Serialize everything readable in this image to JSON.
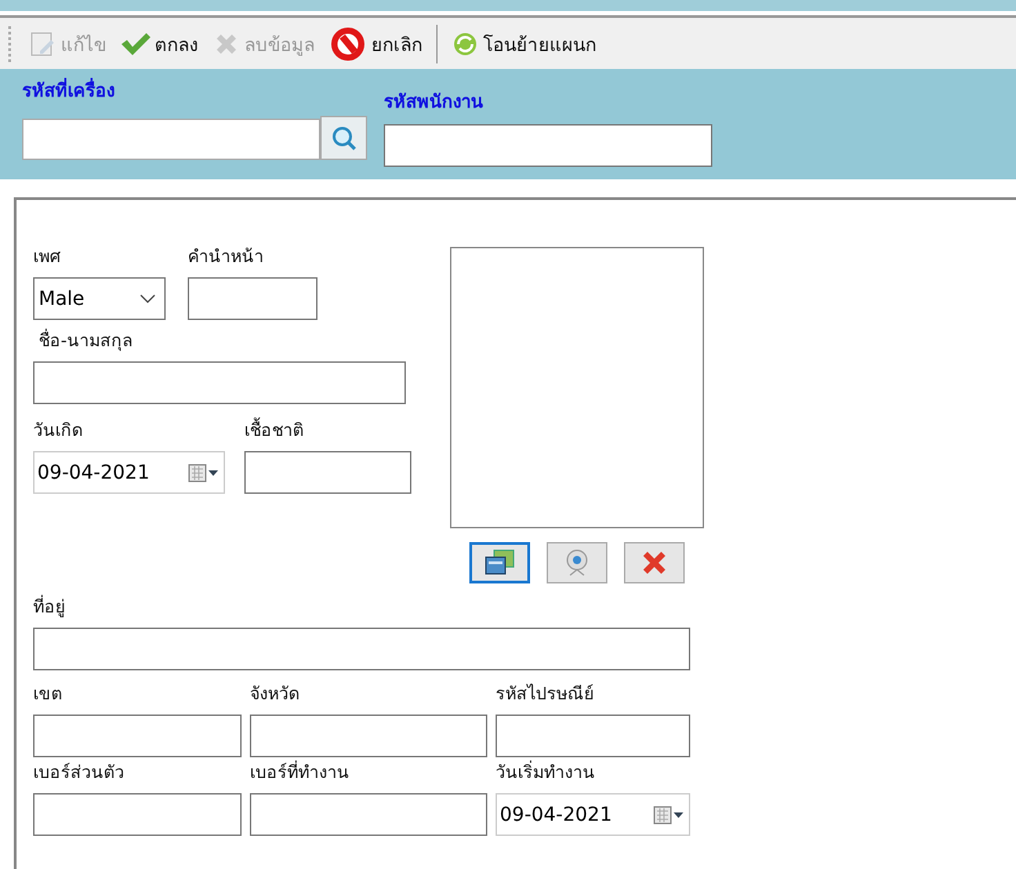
{
  "toolbar": [
    {
      "label": "แก้ไข",
      "kind": "edit",
      "disabled": true
    },
    {
      "label": "ตกลง",
      "kind": "ok",
      "disabled": false
    },
    {
      "label": "ลบข้อมูล",
      "kind": "delete",
      "disabled": true
    },
    {
      "label": "ยกเลิก",
      "kind": "cancel",
      "disabled": false
    },
    {
      "label": "โอนย้ายแผนก",
      "kind": "transfer",
      "disabled": false
    }
  ],
  "header": {
    "machine_code_label": "รหัสที่เครื่อง",
    "employee_code_label": "รหัสพนักงาน"
  },
  "form": {
    "gender_label": "เพศ",
    "gender_value": "Male",
    "prefix_label": "คำนำหน้า",
    "name_label": "ชื่อ-นามสกุล",
    "birth_label": "วันเกิด",
    "birth_value": "09-04-2021",
    "nationality_label": "เชื้อชาติ",
    "address_label": "ที่อยู่",
    "district_label": "เขต",
    "province_label": "จังหวัด",
    "postal_label": "รหัสไปรษณีย์",
    "phone_label": "เบอร์ส่วนตัว",
    "work_phone_label": "เบอร์ที่ทำงาน",
    "start_label": "วันเริ่มทำงาน",
    "start_value": "09-04-2021"
  }
}
